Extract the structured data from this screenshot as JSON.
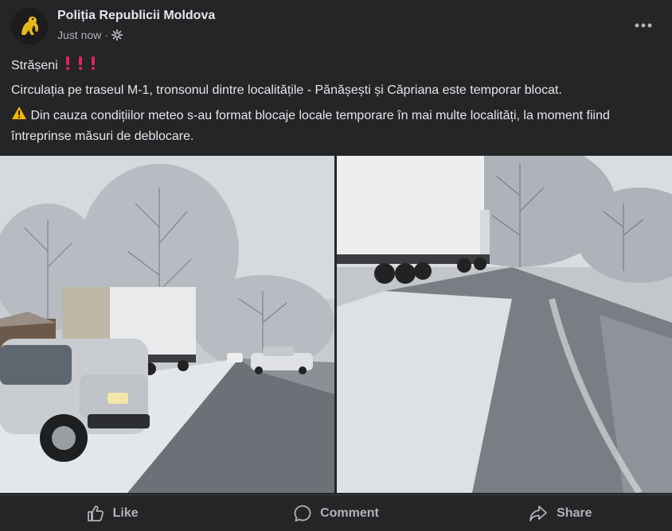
{
  "post": {
    "page_name": "Poliția Republicii Moldova",
    "timestamp": "Just now",
    "separator": "·",
    "privacy_icon": "gear-icon",
    "more_icon": "more-dots-icon",
    "line1": "Strășeni",
    "line1_emojis": "exclamation-mark-icon x3",
    "line2": "Circulația pe traseul M-1, tronsonul dintre localitățile -  Pănășești și Căpriana este temporar blocat.",
    "line3": "Din cauza condițiilor meteo s-au format blocaje locale temporare în mai multe localități, la moment fiind întreprinse măsuri de deblocare.",
    "line3_icon": "warning-icon"
  },
  "actions": {
    "like": "Like",
    "comment": "Comment",
    "share": "Share"
  },
  "colors": {
    "background": "#242526",
    "text": "#e4e6eb",
    "secondary": "#b0b3b8",
    "emoji_red": "#e0245e",
    "warning": "#f7b500"
  }
}
